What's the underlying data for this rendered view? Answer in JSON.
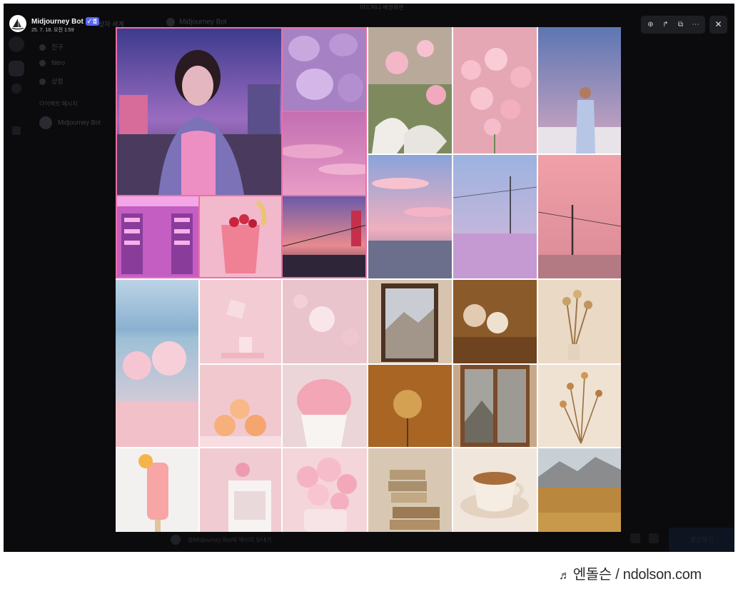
{
  "background": {
    "window_title": "미드저니 배경화면",
    "rail_icons": [
      "direct-messages-icon",
      "server-icon",
      "add-server-icon",
      "download-icon"
    ],
    "sidebar": {
      "items": [
        {
          "icon": "friends-icon",
          "label": "친구"
        },
        {
          "icon": "nitro-icon",
          "label": "Nitro"
        },
        {
          "icon": "shop-icon",
          "label": "상점"
        }
      ],
      "dm_header": "다이렉트 메시지",
      "dm_items": [
        "Midjourney Bot"
      ]
    },
    "channel_title": "Midjourney Bot",
    "tab_label": "상자 세계",
    "message_placeholder": "@Midjourney Bot에 메시지 보내기",
    "send_button": "생성하기"
  },
  "viewer": {
    "author": "Midjourney Bot",
    "badge": "✓ 앱",
    "timestamp": "25. 7. 18. 오전 1:59",
    "toolbar": [
      {
        "name": "zoom-in-icon",
        "glyph": "⊕"
      },
      {
        "name": "forward-icon",
        "glyph": "↱"
      },
      {
        "name": "open-external-icon",
        "glyph": "⧉"
      },
      {
        "name": "more-icon",
        "glyph": "⋯"
      }
    ],
    "close_glyph": "✕",
    "image_alt": "Pink and beige aesthetic moodboard collage"
  },
  "watermark": {
    "note": "♬",
    "text": "엔돌슨 / ndolson.com"
  },
  "colors": {
    "frame_bg": "#0b0b0d",
    "highlight_border": "#ee6fa8",
    "brand_badge": "#5865f2"
  }
}
